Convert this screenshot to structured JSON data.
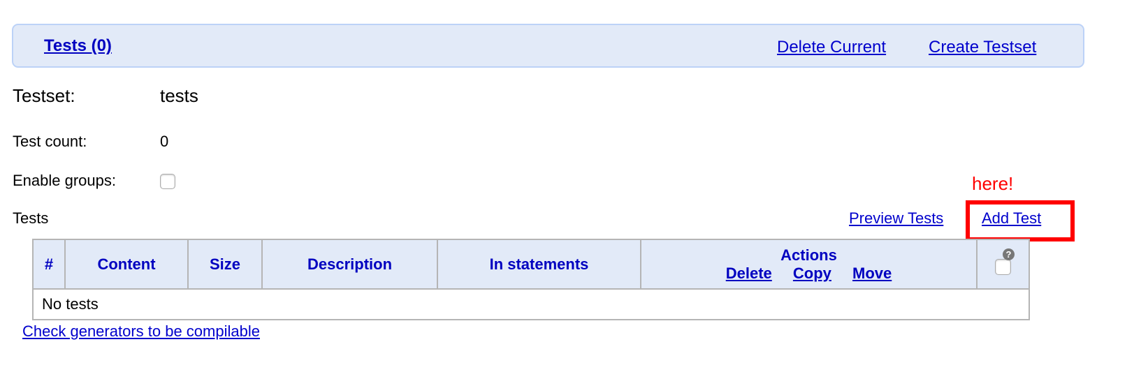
{
  "header": {
    "title": "Tests (0)",
    "delete_current": "Delete Current",
    "create_testset": "Create Testset"
  },
  "testset": {
    "label": "Testset:",
    "value": "tests"
  },
  "test_count": {
    "label": "Test count:",
    "value": "0"
  },
  "enable_groups": {
    "label": "Enable groups:",
    "checked": false
  },
  "tests_section": {
    "label": "Tests",
    "preview_tests": "Preview Tests",
    "add_test": "Add Test"
  },
  "annotation": {
    "text": "here!",
    "color": "#ff0000"
  },
  "table": {
    "columns": [
      "#",
      "Content",
      "Size",
      "Description",
      "In statements",
      "Actions"
    ],
    "actions": [
      "Delete",
      "Copy",
      "Move"
    ],
    "help_icon": "?",
    "empty_text": "No tests"
  },
  "footer_link": "Check generators to be compilable",
  "colors": {
    "link": "#0000cc",
    "header_bg": "#e2eaf8"
  }
}
